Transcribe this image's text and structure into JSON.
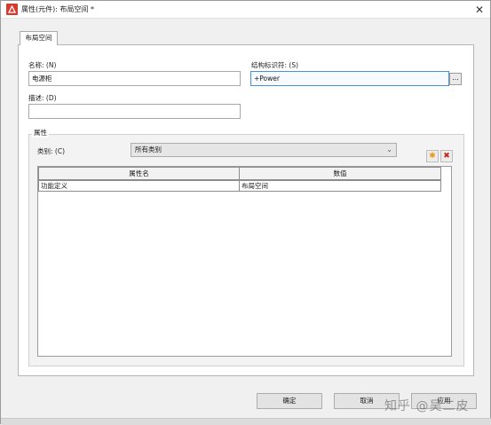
{
  "window": {
    "title": "属性(元件): 布局空间 *",
    "close_symbol": "✕"
  },
  "tabs": [
    {
      "label": "布局空间"
    }
  ],
  "form": {
    "name_label": "名称: (N)",
    "name_value": "电源柜",
    "struct_id_label": "结构标识符: (S)",
    "struct_id_value": "+Power",
    "browse_label": "...",
    "desc_label": "描述: (D)",
    "desc_value": ""
  },
  "properties": {
    "group_title": "属性",
    "category_label": "类别: (C)",
    "category_value": "所有类别",
    "add_symbol": "✱",
    "delete_symbol": "✖",
    "columns": [
      "属性名",
      "数值"
    ],
    "rows": [
      {
        "name": "功能定义",
        "value": "布局空间"
      }
    ]
  },
  "buttons": {
    "ok": "确定",
    "cancel": "取消",
    "apply": "应用"
  },
  "watermark": "知乎 @吴二皮",
  "colors": {
    "app_icon": "#d83b2e",
    "focus_border": "#4a8fd8",
    "add": "#e69a1a",
    "delete": "#c8261c"
  }
}
